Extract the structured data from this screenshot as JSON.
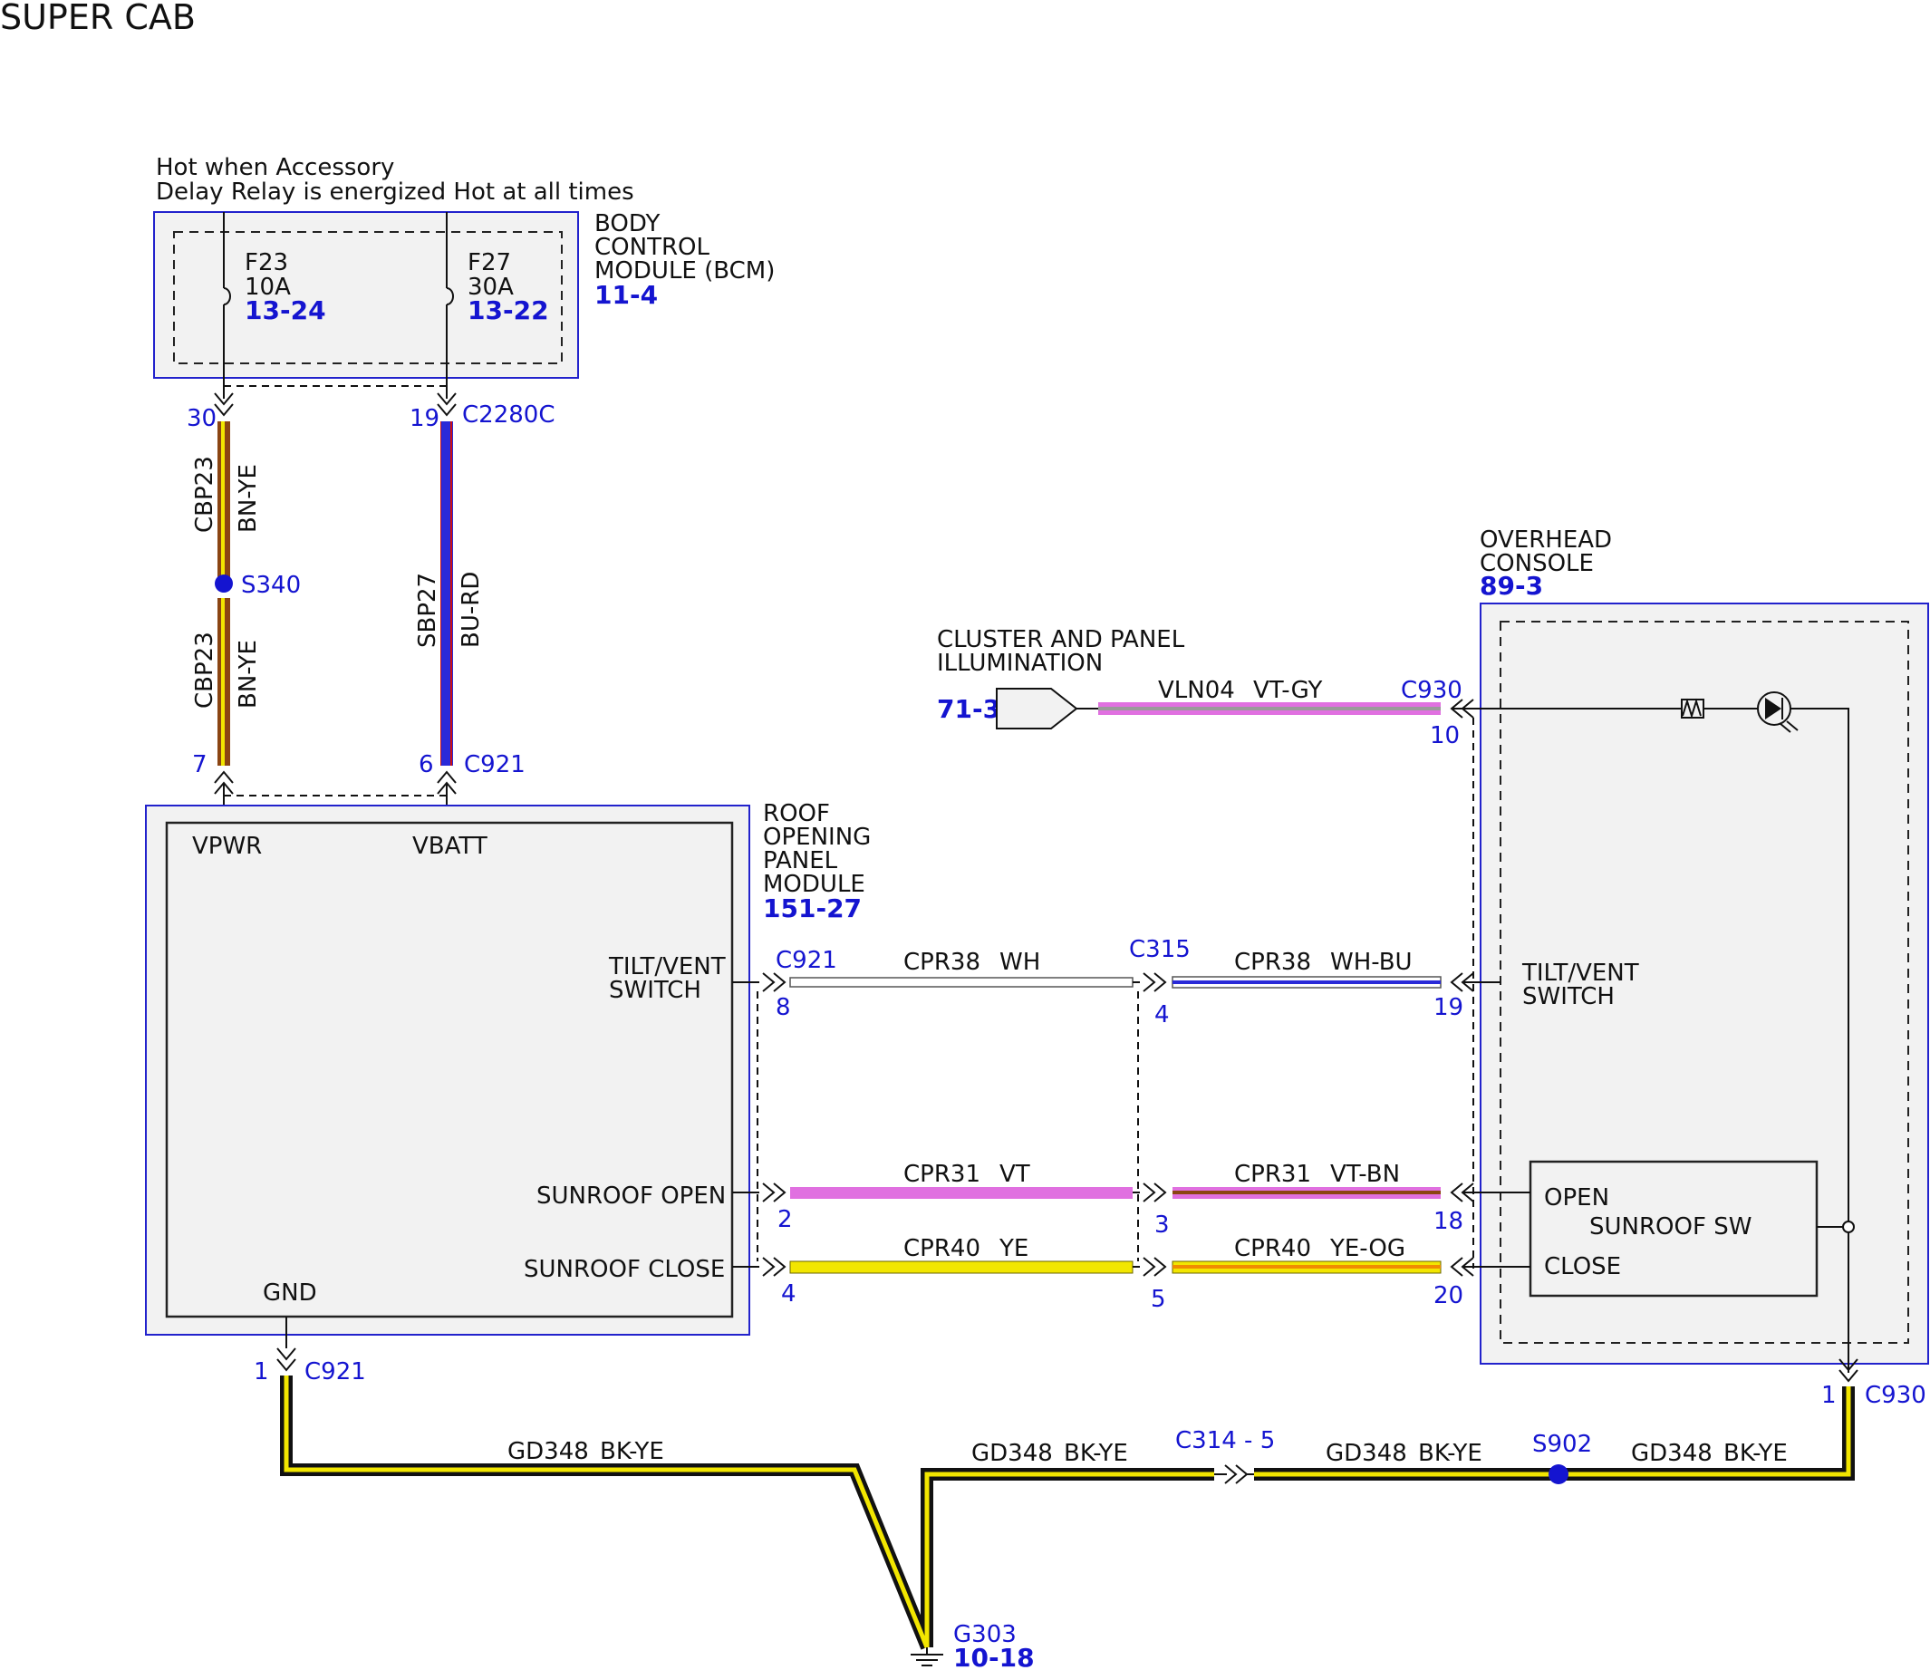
{
  "title": "SUPER CAB",
  "colors": {
    "module_border": "#2222cc",
    "label_blue": "#1414d0",
    "BN": "#8b4513",
    "YE": "#f2e600",
    "BU": "#2a2ad8",
    "RD": "#d01010",
    "VT": "#e070e0",
    "GY": "#9a9a9a",
    "WH": "#ffffff",
    "OG": "#f08c00",
    "BK": "#111111"
  },
  "power": {
    "line1": "Hot when Accessory",
    "line2": "Delay Relay is energized Hot at all times"
  },
  "bcm": {
    "name_l1": "BODY",
    "name_l2": "CONTROL",
    "name_l3": "MODULE (BCM)",
    "ref": "11-4",
    "fuse1": {
      "name": "F23",
      "rating": "10A",
      "ref": "13-24"
    },
    "fuse2": {
      "name": "F27",
      "rating": "30A",
      "ref": "13-22"
    }
  },
  "wires": {
    "w_cbp23_top": {
      "pin_top": "30",
      "circuit": "CBP23",
      "color": "BN-YE"
    },
    "w_cbp23_bot": {
      "circuit": "CBP23",
      "color": "BN-YE",
      "pin_bot": "7"
    },
    "splice_s340": "S340",
    "w_sbp27": {
      "pin_top": "19",
      "conn_top": "C2280C",
      "circuit": "SBP27",
      "color": "BU-RD",
      "pin_bot": "6",
      "conn_bot": "C921"
    },
    "vln04": {
      "circuit": "VLN04",
      "color": "VT-GY",
      "conn": "C930",
      "pin": "10"
    },
    "cpr38_a": {
      "conn": "C921",
      "pin": "8",
      "circuit": "CPR38",
      "color": "WH"
    },
    "cpr38_b": {
      "conn": "C315",
      "pin": "4",
      "circuit": "CPR38",
      "color": "WH-BU",
      "pin_end": "19"
    },
    "cpr31_a": {
      "pin": "2",
      "circuit": "CPR31",
      "color": "VT"
    },
    "cpr31_b": {
      "pin": "3",
      "circuit": "CPR31",
      "color": "VT-BN",
      "pin_end": "18"
    },
    "cpr40_a": {
      "pin": "4",
      "circuit": "CPR40",
      "color": "YE"
    },
    "cpr40_b": {
      "pin": "5",
      "circuit": "CPR40",
      "color": "YE-OG",
      "pin_end": "20"
    },
    "gnd_conn": {
      "pin": "1",
      "conn": "C921"
    },
    "gd348_1": {
      "circuit": "GD348",
      "color": "BK-YE"
    },
    "gd348_2": {
      "circuit": "GD348",
      "color": "BK-YE"
    },
    "gd348_3": {
      "circuit": "GD348",
      "color": "BK-YE"
    },
    "gd348_4": {
      "circuit": "GD348",
      "color": "BK-YE"
    },
    "c314": "C314 - 5",
    "s902": "S902",
    "oc_conn": {
      "pin": "1",
      "conn": "C930"
    }
  },
  "cluster": {
    "line1": "CLUSTER AND PANEL",
    "line2": "ILLUMINATION",
    "ref": "71-3"
  },
  "ropm": {
    "name_l1": "ROOF",
    "name_l2": "OPENING",
    "name_l3": "PANEL",
    "name_l4": "MODULE",
    "ref": "151-27",
    "vpwr": "VPWR",
    "vbatt": "VBATT",
    "tilt_l1": "TILT/VENT",
    "tilt_l2": "SWITCH",
    "open": "SUNROOF OPEN",
    "close": "SUNROOF CLOSE",
    "gnd": "GND"
  },
  "overhead": {
    "name_l1": "OVERHEAD",
    "name_l2": "CONSOLE",
    "ref": "89-3",
    "tilt_l1": "TILT/VENT",
    "tilt_l2": "SWITCH",
    "sw_open": "OPEN",
    "sw_name": "SUNROOF SW",
    "sw_close": "CLOSE"
  },
  "ground": {
    "name": "G303",
    "ref": "10-18"
  }
}
